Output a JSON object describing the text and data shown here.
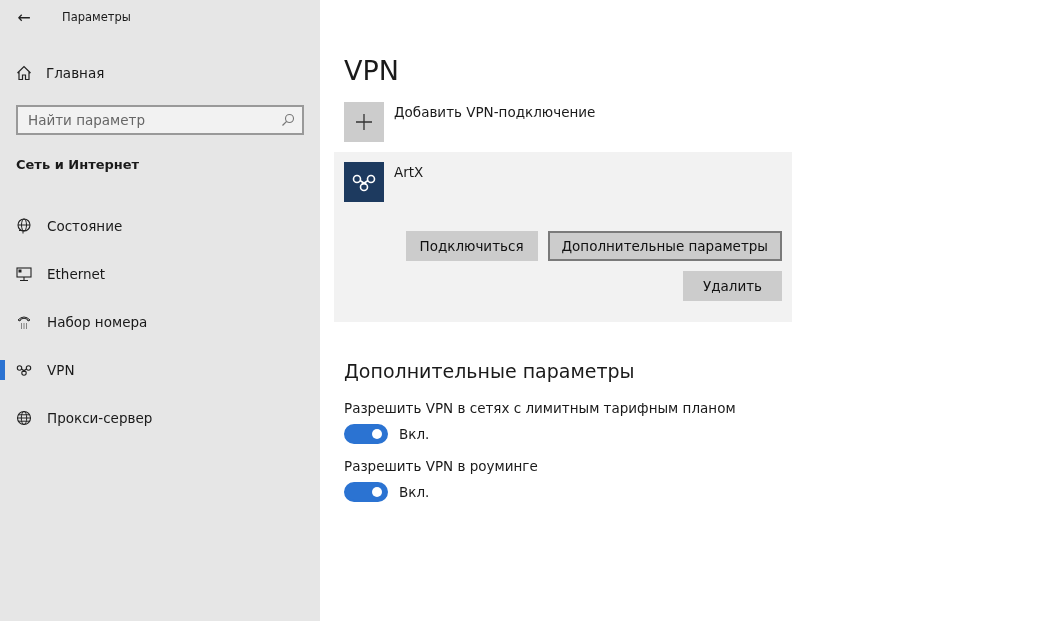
{
  "window": {
    "title": "Параметры",
    "back": "←"
  },
  "sidebar": {
    "home": "Главная",
    "search": {
      "placeholder": "Найти параметр"
    },
    "section": "Сеть и Интернет",
    "items": [
      {
        "label": "Состояние",
        "selected": false
      },
      {
        "label": "Ethernet",
        "selected": false
      },
      {
        "label": "Набор номера",
        "selected": false
      },
      {
        "label": "VPN",
        "selected": true
      },
      {
        "label": "Прокси-сервер",
        "selected": false
      }
    ]
  },
  "page": {
    "title": "VPN",
    "add_label": "Добавить VPN-подключение",
    "connections": [
      {
        "name": "ArtX",
        "buttons": [
          {
            "label": "Подключиться",
            "focused": false
          },
          {
            "label": "Дополнительные параметры",
            "focused": true
          },
          {
            "label": "Удалить",
            "focused": false
          }
        ]
      }
    ],
    "advanced_title": "Дополнительные параметры",
    "toggles": [
      {
        "label": "Разрешить VPN в сетях с лимитным тарифным планом",
        "on": true,
        "state_text": "Вкл."
      },
      {
        "label": "Разрешить VPN в роуминге",
        "on": true,
        "state_text": "Вкл."
      }
    ]
  }
}
